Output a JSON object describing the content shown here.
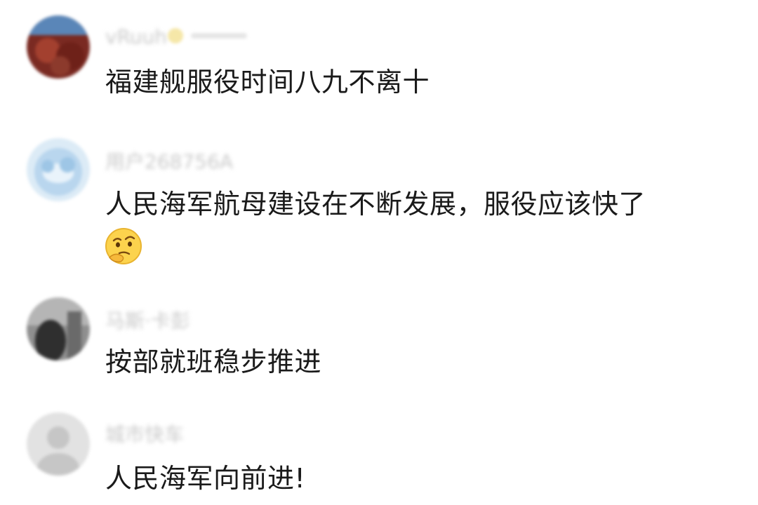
{
  "comments": [
    {
      "username": "vRuuh",
      "text": "福建舰服役时间八九不离十",
      "avatar": "photo-avatar-red"
    },
    {
      "username": "用户268756A",
      "text": "人民海军航母建设在不断发展，服役应该快了",
      "avatar": "cloud-avatar-blue",
      "emoji": "thinking-emoji"
    },
    {
      "username": "马斯·卡彭",
      "text": "按部就班稳步推进",
      "avatar": "photo-avatar-dark"
    },
    {
      "username": "城市快车",
      "text": "人民海军向前进!",
      "avatar": "default-avatar-gray"
    }
  ]
}
